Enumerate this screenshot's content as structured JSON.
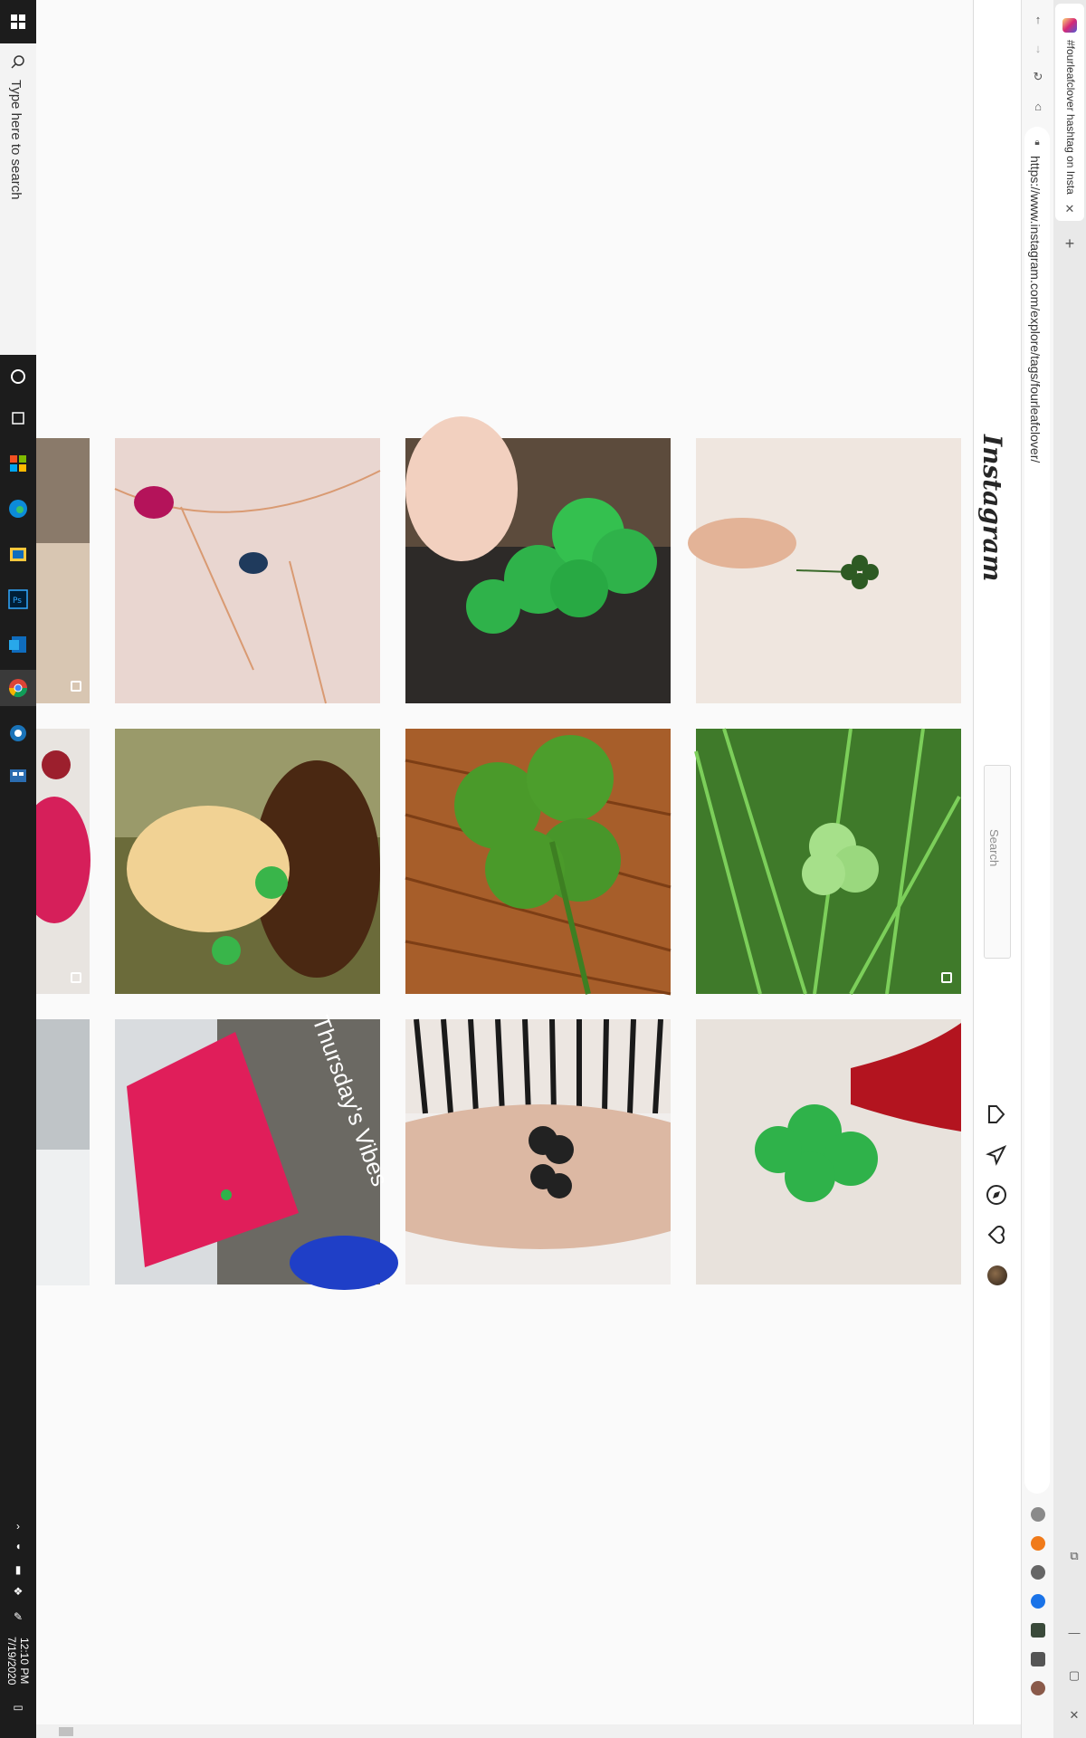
{
  "taskbar": {
    "search_placeholder": "Type here to search",
    "time": "12:10 PM",
    "date": "7/19/2020"
  },
  "browser": {
    "url": "https://www.instagram.com/explore/tags/fourleafclover/",
    "tab_title": "#fourleafclover hashtag on Insta",
    "new_tab_label": "+",
    "close_tab_label": "✕"
  },
  "instagram": {
    "logo_text": "Instagram",
    "search_placeholder": "Search"
  },
  "posts": [
    {
      "subject": "rose gold necklace with pink and blue gemstones",
      "multiple": false
    },
    {
      "subject": "hand holding four-leaf clover over bark",
      "multiple": false
    },
    {
      "subject": "hand holding tiny four-leaf clover",
      "multiple": false
    },
    {
      "subject": "hand holding clover near brown dog",
      "multiple": false
    },
    {
      "subject": "four-leaf clover on wood table",
      "multiple": false
    },
    {
      "subject": "clover in grass",
      "multiple": true
    },
    {
      "subject": "red glitter block with clover",
      "overlay_text": "Thursday's Vibes",
      "multiple": false
    },
    {
      "subject": "four-leaf clover tattoo on arm",
      "multiple": false
    },
    {
      "subject": "red-gloved hand holding clover",
      "multiple": false
    }
  ],
  "colors": {
    "taskbar": "#1c1c1c",
    "page_bg": "#fafafa",
    "clover_green": "#2fb24a"
  }
}
